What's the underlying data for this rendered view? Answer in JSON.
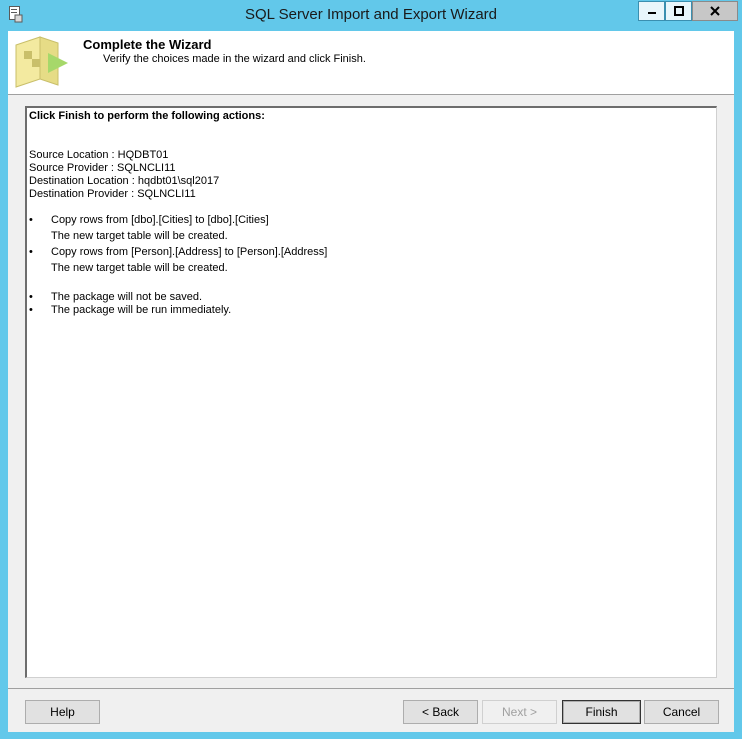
{
  "window": {
    "title": "SQL Server Import and Export Wizard",
    "controls": {
      "minimize_icon": "minimize-icon",
      "maximize_icon": "maximize-icon",
      "close_icon": "close-icon"
    }
  },
  "header": {
    "title": "Complete the Wizard",
    "subtitle": "Verify the choices made in the wizard and click Finish."
  },
  "summary": {
    "heading": "Click Finish to perform the following actions:",
    "details": [
      "Source Location : HQDBT01",
      "Source Provider : SQLNCLI11",
      "Destination Location : hqdbt01\\sql2017",
      "Destination Provider : SQLNCLI11"
    ],
    "copy_actions": [
      {
        "bullet": "•",
        "text": "Copy rows from [dbo].[Cities] to [dbo].[Cities]",
        "note": "The new target table will be created."
      },
      {
        "bullet": "•",
        "text": "Copy rows from [Person].[Address] to [Person].[Address]",
        "note": "The new target table will be created."
      }
    ],
    "package_actions": [
      {
        "bullet": "•",
        "text": "The package will not be saved."
      },
      {
        "bullet": "•",
        "text": "The package will be run immediately."
      }
    ]
  },
  "buttons": {
    "help": "Help",
    "back": "< Back",
    "next": "Next >",
    "finish": "Finish",
    "cancel": "Cancel"
  }
}
